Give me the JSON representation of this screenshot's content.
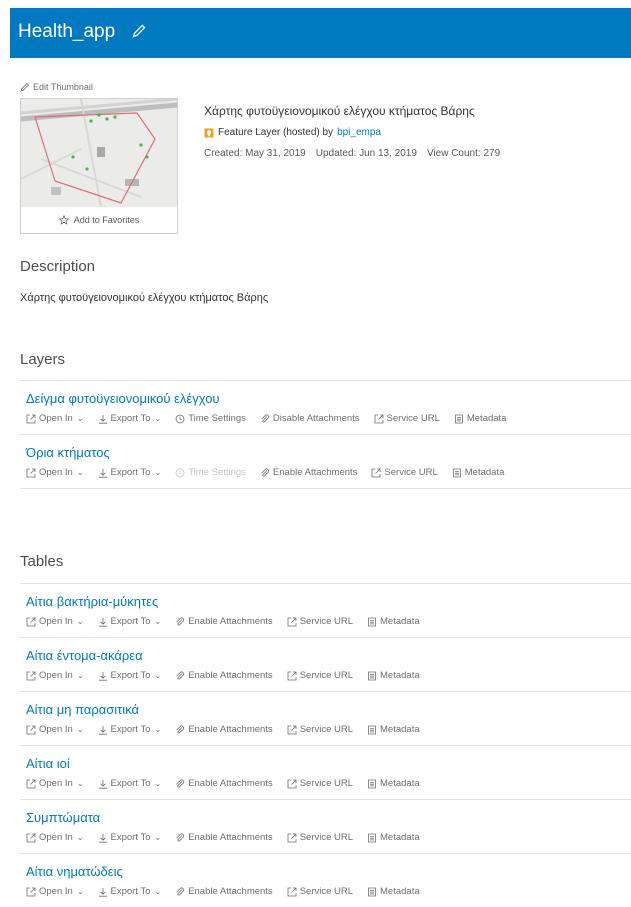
{
  "header": {
    "title": "Health_app"
  },
  "thumbnail": {
    "edit_label": "Edit Thumbnail",
    "favorites_label": "Add to Favorites"
  },
  "item": {
    "description": "Χάρτης φυτοϋγειονομικού ελέγχου κτήματος Βάρης",
    "type_label": "Feature Layer (hosted) by",
    "owner": "bpi_empa",
    "created": "Created: May 31, 2019",
    "updated": "Updated: Jun 13, 2019",
    "views": "View Count: 279"
  },
  "description_section": {
    "title": "Description",
    "text": "Χάρτης φυτοϋγειονομικού ελέγχου κτήματος Βάρης"
  },
  "actions": {
    "open_in": "Open In",
    "export_to": "Export To",
    "time_settings": "Time Settings",
    "disable_attachments": "Disable Attachments",
    "enable_attachments": "Enable Attachments",
    "service_url": "Service URL",
    "metadata": "Metadata"
  },
  "layers": {
    "title": "Layers",
    "items": [
      {
        "name": "Δείγμα φυτοϋγειονομικού ελέγχου"
      },
      {
        "name": "Όρια κτήματος"
      }
    ]
  },
  "tables": {
    "title": "Tables",
    "items": [
      {
        "name": "Αίτια βακτήρια-μύκητες"
      },
      {
        "name": "Αίτια έντομα-ακάρεα"
      },
      {
        "name": "Αίτια μη παρασιτικά"
      },
      {
        "name": "Αίτια ιοί"
      },
      {
        "name": "Συμπτώματα"
      },
      {
        "name": "Αίτια νηματώδεις"
      }
    ]
  },
  "colors": {
    "header": "#0079c1",
    "link": "#0079c1",
    "icon_layer": "#f0a020"
  }
}
